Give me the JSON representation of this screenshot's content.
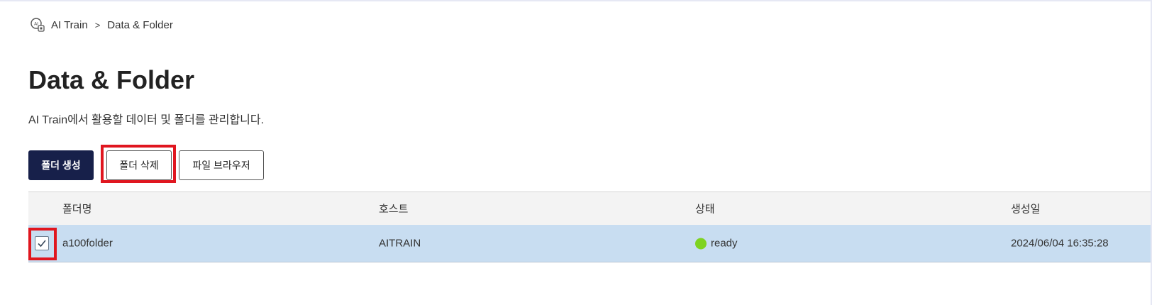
{
  "breadcrumb": {
    "icon": "ai-train-icon",
    "root": "AI Train",
    "separator": ">",
    "current": "Data & Folder"
  },
  "page": {
    "title": "Data & Folder",
    "description": "AI Train에서 활용할 데이터 및 폴더를 관리합니다."
  },
  "toolbar": {
    "create_label": "폴더 생성",
    "delete_label": "폴더 삭제",
    "browser_label": "파일 브라우저"
  },
  "table": {
    "columns": [
      "폴더명",
      "호스트",
      "상태",
      "생성일"
    ],
    "rows": [
      {
        "checked": true,
        "name": "a100folder",
        "host": "AITRAIN",
        "status": "ready",
        "created": "2024/06/04 16:35:28"
      }
    ]
  },
  "colors": {
    "primary": "#17204a",
    "highlight": "#e0161f",
    "selected_row": "#c8ddf1",
    "status_ready": "#7ed321"
  }
}
